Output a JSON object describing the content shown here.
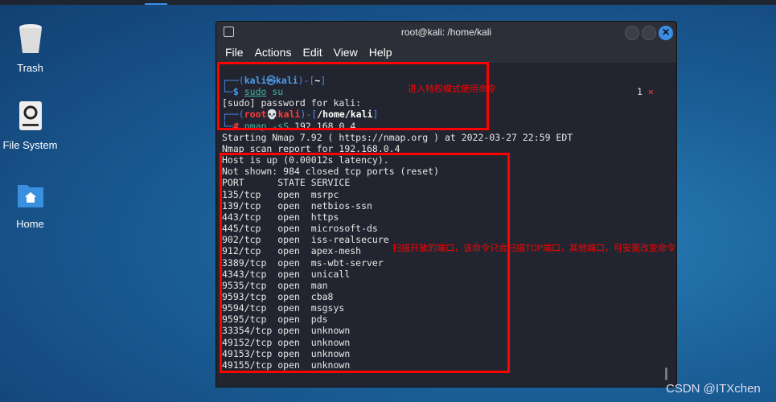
{
  "desktop": {
    "icons": [
      {
        "label": "Trash"
      },
      {
        "label": "File System"
      },
      {
        "label": "Home"
      }
    ]
  },
  "window": {
    "title": "root@kali: /home/kali",
    "menu": [
      "File",
      "Actions",
      "Edit",
      "View",
      "Help"
    ]
  },
  "terminal": {
    "prompt1": {
      "user": "kali",
      "host": "kali",
      "dir": "~",
      "cmd": "sudo",
      "arg": "su"
    },
    "line_sudo": "[sudo] password for kali:",
    "prompt2": {
      "user": "root",
      "host": "kali",
      "dir": "/home/kali",
      "cmd": "nmap",
      "flag": "-sS",
      "arg": "192.168.0.4"
    },
    "exit_code": "1",
    "output": [
      "Starting Nmap 7.92 ( https://nmap.org ) at 2022-03-27 22:59 EDT",
      "Nmap scan report for 192.168.0.4",
      "Host is up (0.00012s latency).",
      "Not shown: 984 closed tcp ports (reset)",
      "PORT      STATE SERVICE",
      "135/tcp   open  msrpc",
      "139/tcp   open  netbios-ssn",
      "443/tcp   open  https",
      "445/tcp   open  microsoft-ds",
      "902/tcp   open  iss-realsecure",
      "912/tcp   open  apex-mesh",
      "3389/tcp  open  ms-wbt-server",
      "4343/tcp  open  unicall",
      "9535/tcp  open  man",
      "9593/tcp  open  cba8",
      "9594/tcp  open  msgsys",
      "9595/tcp  open  pds",
      "33354/tcp open  unknown",
      "49152/tcp open  unknown",
      "49153/tcp open  unknown",
      "49155/tcp open  unknown"
    ]
  },
  "annotations": {
    "note1": "进入特权模式使用命令",
    "note2": "扫描开放的端口，该命令只会扫描TCP端口，其他端口，可安需改变命令",
    "color": "#ff0000"
  },
  "watermark": "CSDN @ITXchen"
}
